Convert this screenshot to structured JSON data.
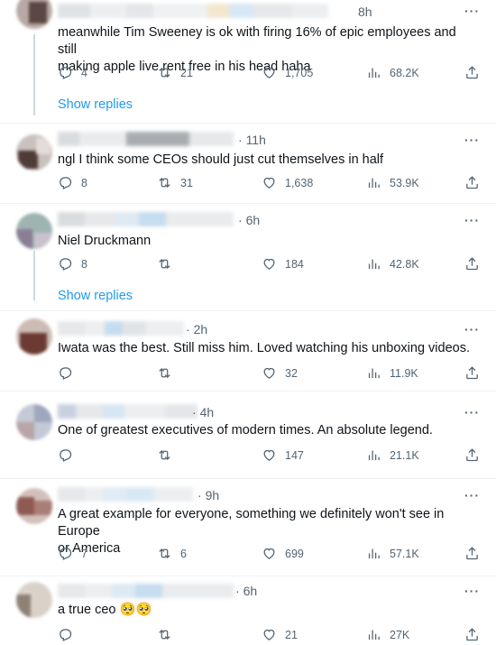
{
  "icons": {
    "reply": "reply-icon",
    "retweet": "retweet-icon",
    "like": "heart-icon",
    "views": "views-icon",
    "share": "share-icon",
    "more": "more-icon"
  },
  "more_label": "···",
  "accent_color": "#1d9bf0",
  "tweets": [
    {
      "time": "8h",
      "lines": [
        "meanwhile Tim Sweeney is ok with firing 16% of epic employees and still",
        "making apple live rent free in his head haha"
      ],
      "replies": "4",
      "retweets": "21",
      "likes": "1,705",
      "views": "68.2K",
      "show_replies": "Show replies"
    },
    {
      "time": "11h",
      "lines": [
        "ngl I think some CEOs should just cut themselves in half"
      ],
      "replies": "8",
      "retweets": "31",
      "likes": "1,638",
      "views": "53.9K"
    },
    {
      "time": "6h",
      "lines": [
        "Niel Druckmann"
      ],
      "replies": "8",
      "retweets": "",
      "likes": "184",
      "views": "42.8K",
      "show_replies": "Show replies"
    },
    {
      "time": "2h",
      "lines": [
        "Iwata was the best. Still miss him. Loved watching his unboxing videos."
      ],
      "replies": "",
      "retweets": "",
      "likes": "32",
      "views": "11.9K"
    },
    {
      "time": "4h",
      "lines": [
        "One of greatest executives of modern times.  An absolute legend."
      ],
      "replies": "",
      "retweets": "",
      "likes": "147",
      "views": "21.1K"
    },
    {
      "time": "9h",
      "lines": [
        "A great example for everyone, something we definitely won't see in Europe",
        "or America"
      ],
      "replies": "7",
      "retweets": "6",
      "likes": "699",
      "views": "57.1K"
    },
    {
      "time": "6h",
      "lines": [
        "a true ceo 🥺🥺"
      ],
      "replies": "",
      "retweets": "",
      "likes": "21",
      "views": "27K"
    }
  ]
}
